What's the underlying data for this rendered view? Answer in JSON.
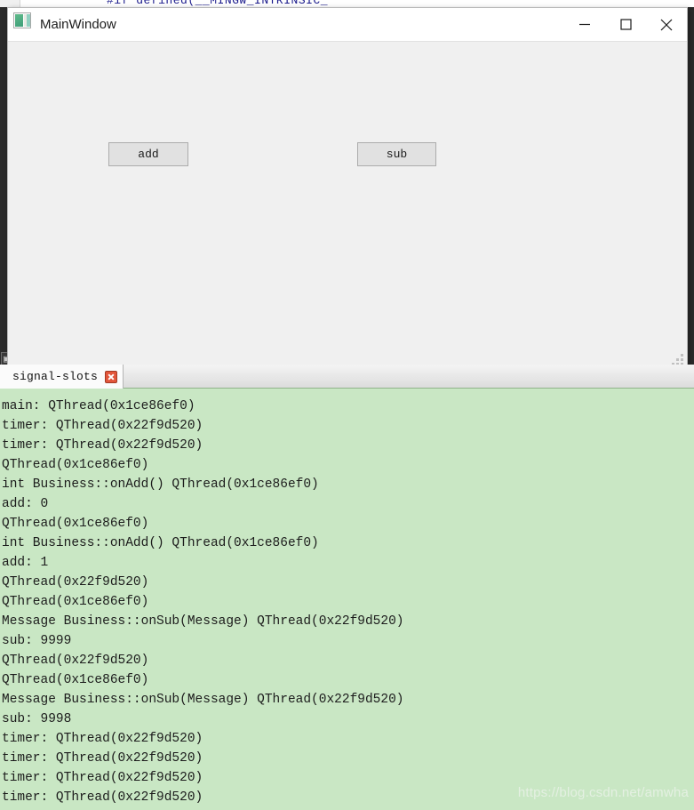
{
  "backdrop": {
    "code_sliver": "#if defined(__MINGW_INTRINSIC_"
  },
  "main_window": {
    "title": "MainWindow",
    "app_icon": "qt-app-icon",
    "controls": {
      "minimize": "minimize-icon",
      "maximize": "maximize-icon",
      "close": "close-icon"
    },
    "buttons": [
      {
        "label": "add",
        "name": "add-button"
      },
      {
        "label": "sub",
        "name": "sub-button"
      }
    ],
    "resize_grip": "resize-grip-icon"
  },
  "console": {
    "tab_label": "signal-slots",
    "tab_close_icon": "close-icon",
    "watermark": "https://blog.csdn.net/amwha",
    "lines": [
      "main: QThread(0x1ce86ef0)",
      "timer: QThread(0x22f9d520)",
      "timer: QThread(0x22f9d520)",
      "QThread(0x1ce86ef0)",
      "int Business::onAdd() QThread(0x1ce86ef0)",
      "add: 0",
      "QThread(0x1ce86ef0)",
      "int Business::onAdd() QThread(0x1ce86ef0)",
      "add: 1",
      "QThread(0x22f9d520)",
      "QThread(0x1ce86ef0)",
      "Message Business::onSub(Message) QThread(0x22f9d520)",
      "sub: 9999",
      "QThread(0x22f9d520)",
      "QThread(0x1ce86ef0)",
      "Message Business::onSub(Message) QThread(0x22f9d520)",
      "sub: 9998",
      "timer: QThread(0x22f9d520)",
      "timer: QThread(0x22f9d520)",
      "timer: QThread(0x22f9d520)",
      "timer: QThread(0x22f9d520)"
    ]
  },
  "colors": {
    "console_background": "#c9e7c4",
    "window_client": "#f0f0f0",
    "title_bar": "#ffffff",
    "tab_close_red": "#e2553a",
    "desktop": "#2b2b2b"
  }
}
